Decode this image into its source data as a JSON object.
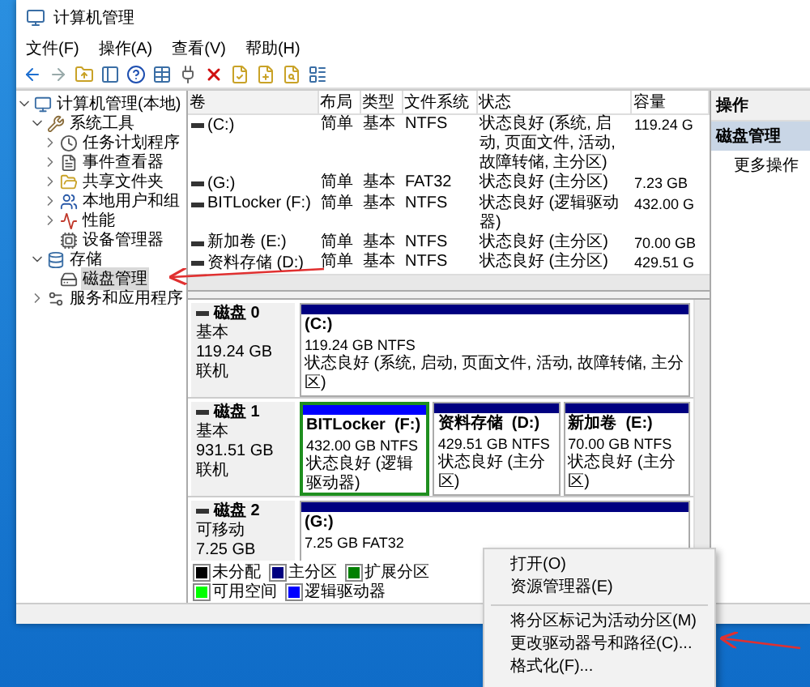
{
  "window": {
    "title": "计算机管理"
  },
  "menu": [
    "文件(F)",
    "操作(A)",
    "查看(V)",
    "帮助(H)"
  ],
  "tree": [
    {
      "label": "计算机管理(本地)",
      "kind": "computer",
      "expanded": true,
      "selected": false,
      "children": [
        {
          "label": "系统工具",
          "kind": "tools",
          "expanded": true,
          "selected": false,
          "children": [
            {
              "label": "任务计划程序",
              "kind": "clock",
              "expanded": false,
              "selected": false
            },
            {
              "label": "事件查看器",
              "kind": "log",
              "expanded": false,
              "selected": false
            },
            {
              "label": "共享文件夹",
              "kind": "folder",
              "expanded": false,
              "selected": false
            },
            {
              "label": "本地用户和组",
              "kind": "users",
              "expanded": false,
              "selected": false
            },
            {
              "label": "性能",
              "kind": "perf",
              "expanded": false,
              "selected": false
            },
            {
              "label": "设备管理器",
              "kind": "device",
              "selected": false
            }
          ]
        },
        {
          "label": "存储",
          "kind": "storage",
          "expanded": true,
          "selected": false,
          "children": [
            {
              "label": "磁盘管理",
              "kind": "disk",
              "selected": true
            }
          ]
        },
        {
          "label": "服务和应用程序",
          "kind": "services",
          "expanded": false,
          "selected": false
        }
      ]
    }
  ],
  "volumes": {
    "columns": [
      "卷",
      "布局",
      "类型",
      "文件系统",
      "状态",
      "容量"
    ],
    "rows": [
      {
        "cells": [
          "(C:)",
          "简单",
          "基本",
          "NTFS",
          "状态良好 (系统, 启动, 页面文件, 活动, 故障转储, 主分区)",
          "119.24 G"
        ]
      },
      {
        "cells": [
          "(G:)",
          "简单",
          "基本",
          "FAT32",
          "状态良好 (主分区)",
          "7.23 GB"
        ]
      },
      {
        "cells": [
          "BITLocker (F:)",
          "简单",
          "基本",
          "NTFS",
          "状态良好 (逻辑驱动器)",
          "432.00 G"
        ]
      },
      {
        "cells": [
          "新加卷 (E:)",
          "简单",
          "基本",
          "NTFS",
          "状态良好 (主分区)",
          "70.00 GB"
        ]
      },
      {
        "cells": [
          "资料存储 (D:)",
          "简单",
          "基本",
          "NTFS",
          "状态良好 (主分区)",
          "429.51 G"
        ]
      }
    ]
  },
  "disks": [
    {
      "name": "磁盘 0",
      "type": "基本",
      "size": "119.24 GB",
      "status": "联机",
      "partitions": [
        {
          "name": "(C:)",
          "size": "119.24 GB NTFS",
          "status": "状态良好 (系统, 启动, 页面文件, 活动, 故障转储, 主分区)",
          "kind": "primary",
          "selected": false
        }
      ]
    },
    {
      "name": "磁盘 1",
      "type": "基本",
      "size": "931.51 GB",
      "status": "联机",
      "partitions": [
        {
          "name": "BITLocker  (F:)",
          "size": "432.00 GB NTFS",
          "status": "状态良好 (逻辑驱动器)",
          "kind": "logical",
          "selected": true
        },
        {
          "name": "资料存储  (D:)",
          "size": "429.51 GB NTFS",
          "status": "状态良好 (主分区)",
          "kind": "primary",
          "selected": false
        },
        {
          "name": "新加卷  (E:)",
          "size": "70.00 GB NTFS",
          "status": "状态良好 (主分区)",
          "kind": "primary",
          "selected": false
        }
      ]
    },
    {
      "name": "磁盘 2",
      "type": "可移动",
      "size": "7.25 GB",
      "partitions": [
        {
          "name": "(G:)",
          "size": "7.25 GB FAT32",
          "kind": "primary",
          "selected": false
        }
      ]
    }
  ],
  "legend": [
    {
      "label": "未分配",
      "color": "#000000"
    },
    {
      "label": "主分区",
      "color": "#000080"
    },
    {
      "label": "扩展分区",
      "color": "#008000"
    },
    {
      "label": "可用空间",
      "color": "#00ff00"
    },
    {
      "label": "逻辑驱动器",
      "color": "#0000ff"
    }
  ],
  "actions": {
    "title": "操作",
    "items": [
      {
        "label": "磁盘管理",
        "kind": "section"
      },
      {
        "label": "更多操作",
        "kind": "item"
      }
    ]
  },
  "context_menu": [
    {
      "label": "打开(O)",
      "kind": "item"
    },
    {
      "label": "资源管理器(E)",
      "kind": "item"
    },
    {
      "kind": "separator"
    },
    {
      "label": "将分区标记为活动分区(M)",
      "kind": "item"
    },
    {
      "label": "更改驱动器号和路径(C)...",
      "kind": "item"
    },
    {
      "label": "格式化(F)...",
      "kind": "item"
    }
  ]
}
